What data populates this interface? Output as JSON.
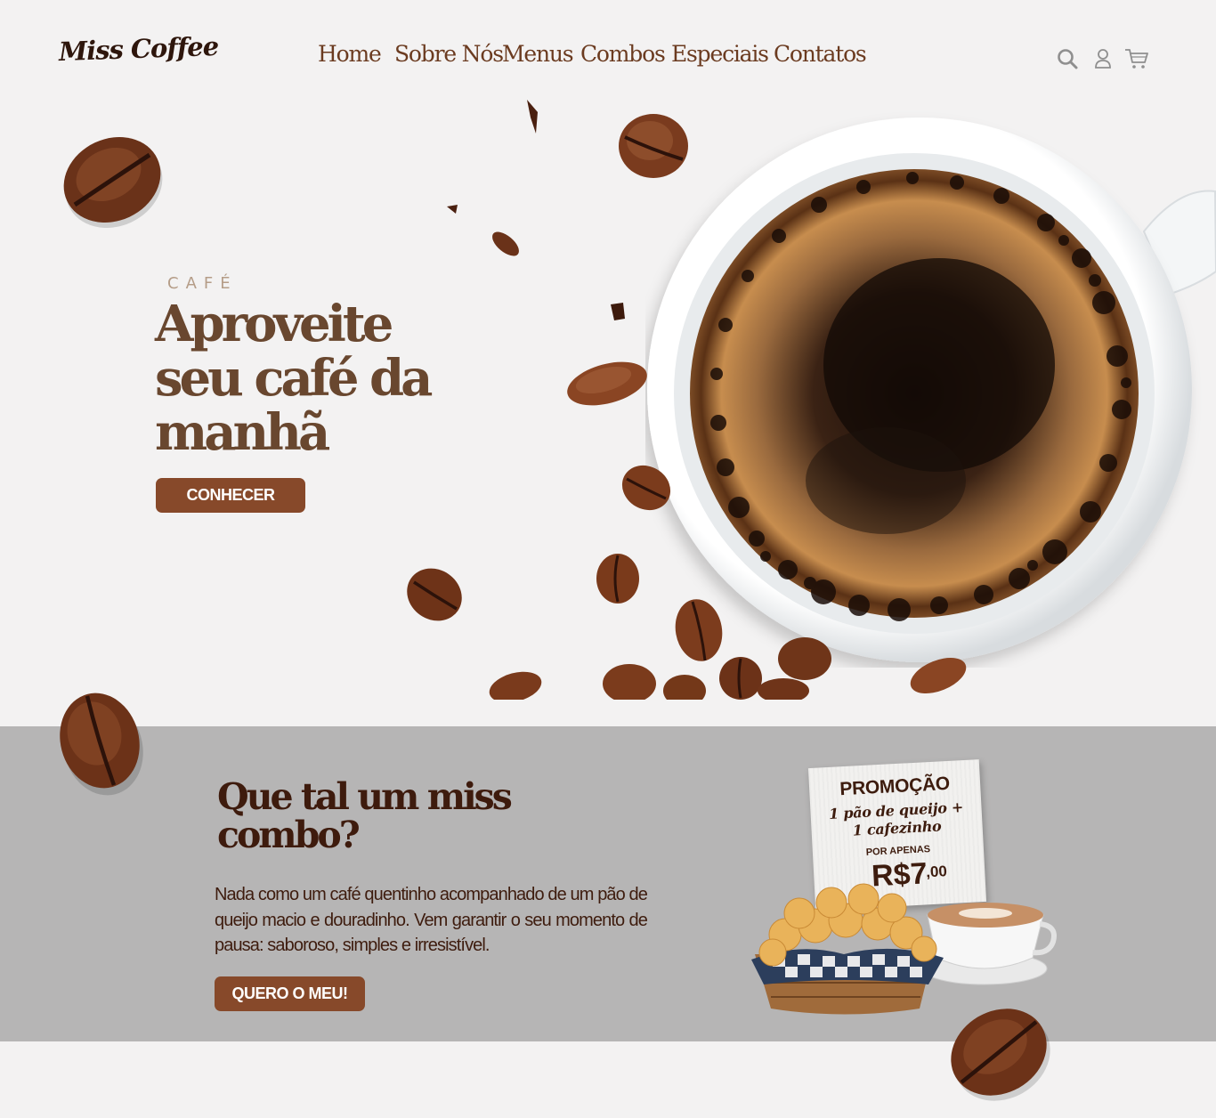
{
  "header": {
    "logo": "Miss Coffee",
    "nav": [
      {
        "label": "Home"
      },
      {
        "label": "Sobre Nós"
      },
      {
        "label": "Menus"
      },
      {
        "label": "Combos"
      },
      {
        "label": "Especiais"
      },
      {
        "label": "Contatos"
      }
    ],
    "icons": [
      "search-icon",
      "user-icon",
      "cart-icon"
    ]
  },
  "hero": {
    "eyebrow": "CAFÉ",
    "title": "Aproveite seu café da manhã",
    "button": "CONHECER"
  },
  "combo": {
    "title": "Que tal um miss combo?",
    "text": "Nada como um café quentinho acompanhado de um pão de queijo macio e douradinho. Vem garantir o seu momento de pausa: saboroso, simples e irresistível.",
    "button": "QUERO O MEU!",
    "promo": {
      "title": "PROMOÇÃO",
      "line1": "1 pão de queijo +",
      "line2": "1 cafezinho",
      "subtitle": "POR APENAS",
      "price": "R$7",
      "cents": ",00"
    }
  },
  "colors": {
    "background": "#f3f2f2",
    "accent_button": "#87492a",
    "nav_text": "#6b3b20",
    "combo_band": "#b6b5b5",
    "dark_brown": "#3e1b0d"
  }
}
